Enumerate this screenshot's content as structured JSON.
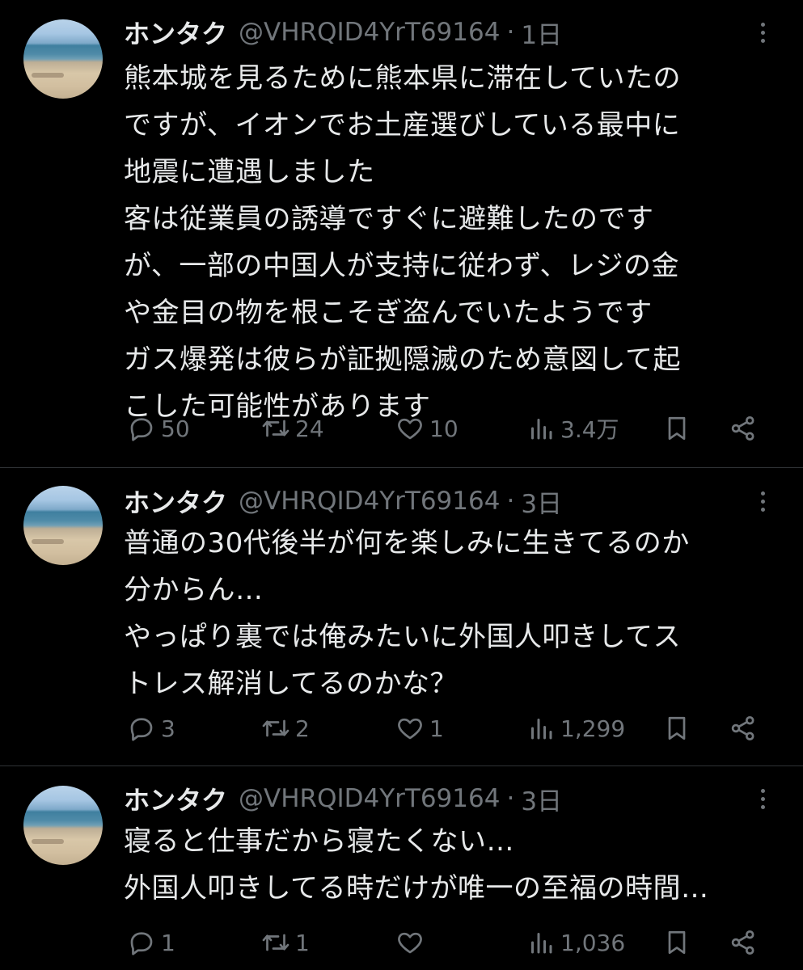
{
  "colors": {
    "background": "#000000",
    "text_primary": "#e7e9ea",
    "text_secondary": "#71767b",
    "divider": "#2f3336"
  },
  "tweets": [
    {
      "name": "ホンタク",
      "handle": "@VHRQID4YrT69164",
      "separator": "·",
      "time": "1日",
      "lines": [
        "熊本城を見るために熊本県に滞在していたの",
        "ですが、イオンでお土産選びしている最中に",
        "地震に遭遇しました",
        "客は従業員の誘導ですぐに避難したのです",
        "が、一部の中国人が支持に従わず、レジの金",
        "や金目の物を根こそぎ盗んでいたようです",
        "ガス爆発は彼らが証拠隠滅のため意図して起",
        "こした可能性があります"
      ],
      "reply_count": "50",
      "retweet_count": "24",
      "like_count": "10",
      "view_count": "3.4万"
    },
    {
      "name": "ホンタク",
      "handle": "@VHRQID4YrT69164",
      "separator": "·",
      "time": "3日",
      "lines": [
        "普通の30代後半が何を楽しみに生きてるのか",
        "分からん…",
        "やっぱり裏では俺みたいに外国人叩きしてス",
        "トレス解消してるのかな？"
      ],
      "reply_count": "3",
      "retweet_count": "2",
      "like_count": "1",
      "view_count": "1,299"
    },
    {
      "name": "ホンタク",
      "handle": "@VHRQID4YrT69164",
      "separator": "·",
      "time": "3日",
      "lines": [
        "寝ると仕事だから寝たくない…",
        "外国人叩きしてる時だけが唯一の至福の時間…"
      ],
      "reply_count": "1",
      "retweet_count": "1",
      "like_count": "",
      "view_count": "1,036"
    }
  ],
  "icons": {
    "reply": "reply-icon",
    "retweet": "retweet-icon",
    "like": "heart-icon",
    "views": "views-icon",
    "bookmark": "bookmark-icon",
    "share": "share-icon",
    "more": "more-icon"
  }
}
